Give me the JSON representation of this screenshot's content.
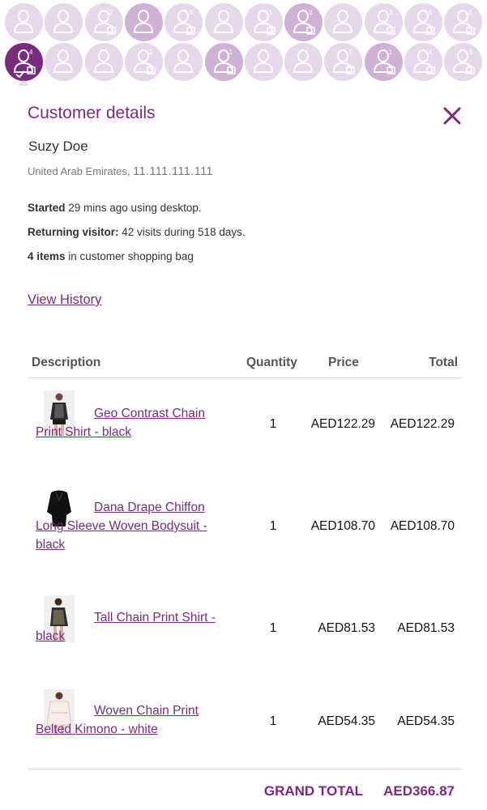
{
  "visitors": {
    "row1": [
      {
        "badge": "",
        "tone": "light",
        "bag": false
      },
      {
        "badge": "",
        "tone": "light",
        "bag": false
      },
      {
        "badge": "2",
        "tone": "light",
        "bag": true
      },
      {
        "badge": "",
        "tone": "mid",
        "bag": false
      },
      {
        "badge": "4",
        "tone": "light",
        "bag": true
      },
      {
        "badge": "",
        "tone": "light",
        "bag": false
      },
      {
        "badge": "1",
        "tone": "light",
        "bag": true
      },
      {
        "badge": "3",
        "tone": "mid",
        "bag": true
      },
      {
        "badge": "",
        "tone": "light",
        "bag": false
      },
      {
        "badge": "3",
        "tone": "light",
        "bag": true
      },
      {
        "badge": "6",
        "tone": "light",
        "bag": true
      },
      {
        "badge": "8",
        "tone": "light",
        "bag": true
      }
    ],
    "row2": [
      {
        "badge": "4",
        "tone": "selected",
        "bag": true
      },
      {
        "badge": "",
        "tone": "light",
        "bag": false
      },
      {
        "badge": "",
        "tone": "light",
        "bag": false
      },
      {
        "badge": "2",
        "tone": "light",
        "bag": true
      },
      {
        "badge": "",
        "tone": "light",
        "bag": false
      },
      {
        "badge": "1",
        "tone": "mid",
        "bag": true
      },
      {
        "badge": "",
        "tone": "light",
        "bag": false
      },
      {
        "badge": "",
        "tone": "light",
        "bag": false
      },
      {
        "badge": "5",
        "tone": "light",
        "bag": true
      },
      {
        "badge": "1",
        "tone": "mid",
        "bag": true
      },
      {
        "badge": "4",
        "tone": "light",
        "bag": true
      },
      {
        "badge": "3",
        "tone": "light",
        "bag": true
      }
    ]
  },
  "panel": {
    "title": "Customer details",
    "close_icon": "close-icon"
  },
  "customer": {
    "name": "Suzy Doe",
    "country": "United Arab Emirates,",
    "ip": "11.111.111.111"
  },
  "session": {
    "started_label": "Started",
    "started_text": " 29 mins ago using desktop.",
    "returning_label": "Returning visitor:",
    "returning_text": " 42 visits during 518 days.",
    "items_label": "4 items",
    "items_text": " in customer shopping bag"
  },
  "view_history_label": "View History",
  "table": {
    "headers": {
      "description": "Description",
      "quantity": "Quantity",
      "price": "Price",
      "total": "Total"
    },
    "rows": [
      {
        "name": "Geo Contrast Chain Print Shirt - black",
        "qty": "1",
        "price": "AED122.29",
        "total": "AED122.29"
      },
      {
        "name": "Dana Drape Chiffon Long Sleeve Woven Bodysuit - black",
        "qty": "1",
        "price": "AED108.70",
        "total": "AED108.70"
      },
      {
        "name": "Tall Chain Print Shirt - black",
        "qty": "1",
        "price": "AED81.53",
        "total": "AED81.53"
      },
      {
        "name": "Woven Chain Print Belted Kimono - white",
        "qty": "1",
        "price": "AED54.35",
        "total": "AED54.35"
      }
    ],
    "grand_total_label": "GRAND TOTAL",
    "grand_total_value": "AED366.87"
  },
  "colors": {
    "accent": "#7a2a7f",
    "avatar_light": "#e6d7ea",
    "avatar_mid": "#cfb1d5",
    "avatar_selected": "#7a2a7f"
  }
}
